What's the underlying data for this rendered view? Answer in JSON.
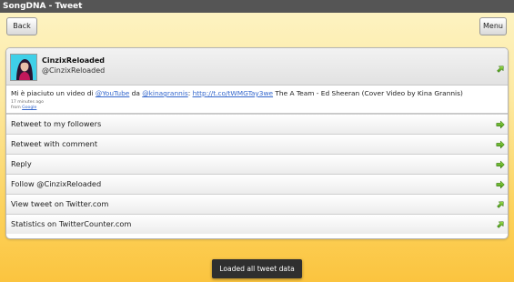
{
  "app": {
    "title": "SongDNA - Tweet"
  },
  "toolbar": {
    "back_label": "Back",
    "menu_label": "Menu"
  },
  "tweet": {
    "username": "CinzixReloaded",
    "handle": "@CinzixReloaded",
    "text_prefix": "Mi è piaciuto un video di ",
    "mention_youtube": "@YouTube",
    "text_da": " da ",
    "mention_kina": "@kinagrannis",
    "text_colon": ": ",
    "link": "http://t.co/tWMGTay3we",
    "text_suffix": " The A Team - Ed Sheeran (Cover Video by Kina Grannis)",
    "time": "17 minutes ago",
    "source_prefix": "from ",
    "source": "Google"
  },
  "actions": [
    {
      "label": "Retweet to my followers",
      "icon": "arrow-right-icon"
    },
    {
      "label": "Retweet with comment",
      "icon": "arrow-right-icon"
    },
    {
      "label": "Reply",
      "icon": "arrow-right-icon"
    },
    {
      "label": "Follow @CinzixReloaded",
      "icon": "arrow-right-icon"
    },
    {
      "label": "View tweet on Twitter.com",
      "icon": "arrow-up-right-icon"
    },
    {
      "label": "Statistics on TwitterCounter.com",
      "icon": "arrow-up-right-icon"
    }
  ],
  "toast": {
    "message": "Loaded all tweet data"
  },
  "colors": {
    "accent_green": "#5cad1e",
    "link": "#3366cc",
    "background": "#fcd25c"
  }
}
